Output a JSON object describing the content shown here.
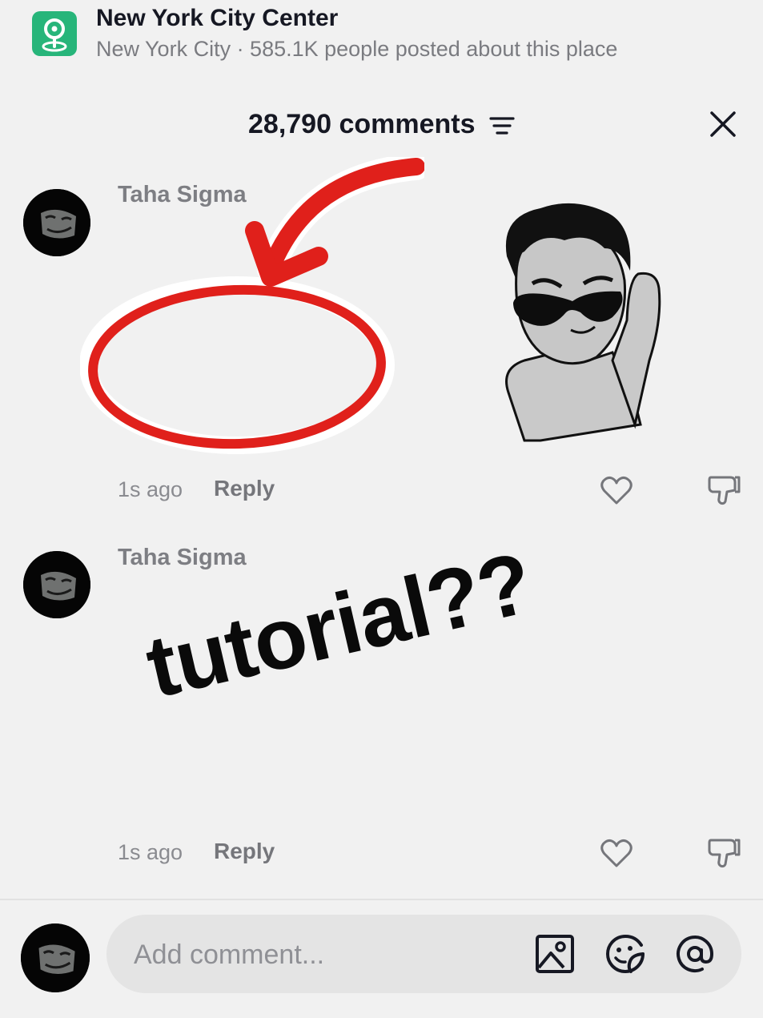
{
  "location": {
    "title": "New York City Center",
    "subtitle": "New York City · 585.1K people posted about this place",
    "icon": "location-pin-icon",
    "icon_color": "#27b57a"
  },
  "comments_header": {
    "title": "28,790 comments",
    "filter_icon": "filter-icon",
    "close_icon": "close-icon"
  },
  "comments": [
    {
      "username": "Taha Sigma",
      "time": "1s ago",
      "reply_label": "Reply",
      "sticker": "red-circle-arrow-and-sunglasses-cartoon"
    },
    {
      "username": "Taha Sigma",
      "time": "1s ago",
      "reply_label": "Reply",
      "sticker_text": "tutorial??"
    }
  ],
  "composer": {
    "placeholder": "Add comment...",
    "tools": [
      "image-icon",
      "emoji-sticker-icon",
      "mention-at-icon"
    ]
  },
  "colors": {
    "accent_red": "#e0201b",
    "background": "#f1f1f1"
  }
}
